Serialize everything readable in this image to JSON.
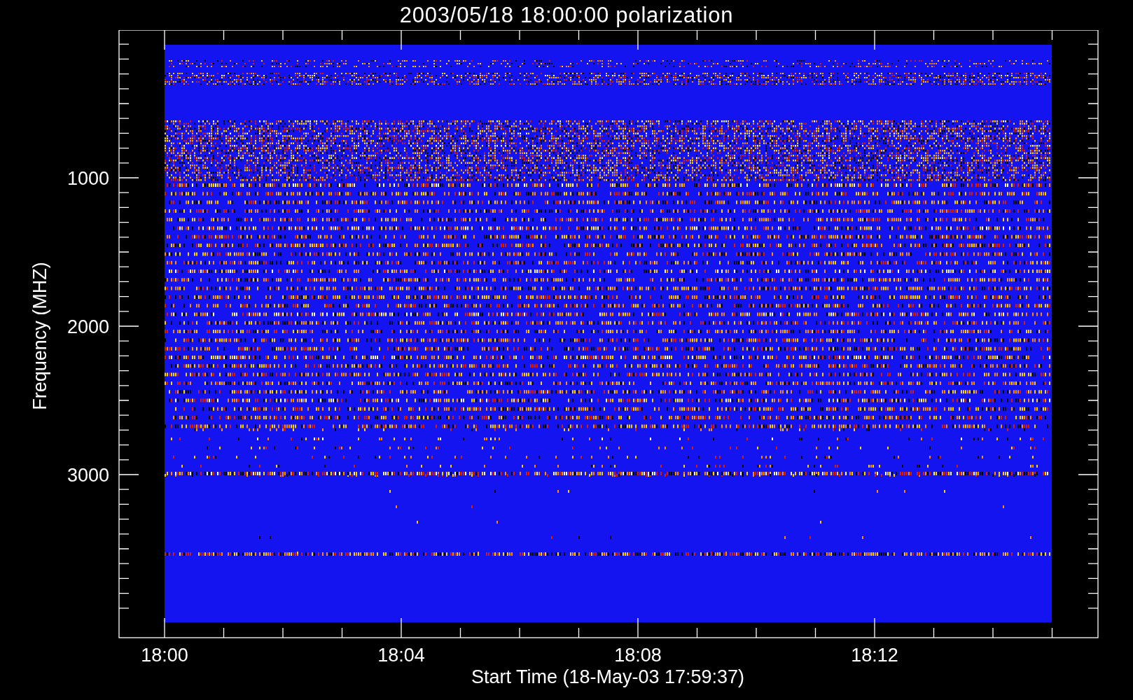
{
  "title": "2003/05/18 18:00:00 polarization",
  "y_axis": {
    "title": "Frequency (MHZ)",
    "tick_labels": [
      "1000",
      "2000",
      "3000"
    ]
  },
  "x_axis": {
    "title": "Start Time (18-May-03 17:59:37)",
    "tick_labels": [
      "18:00",
      "18:04",
      "18:08",
      "18:12"
    ]
  }
}
